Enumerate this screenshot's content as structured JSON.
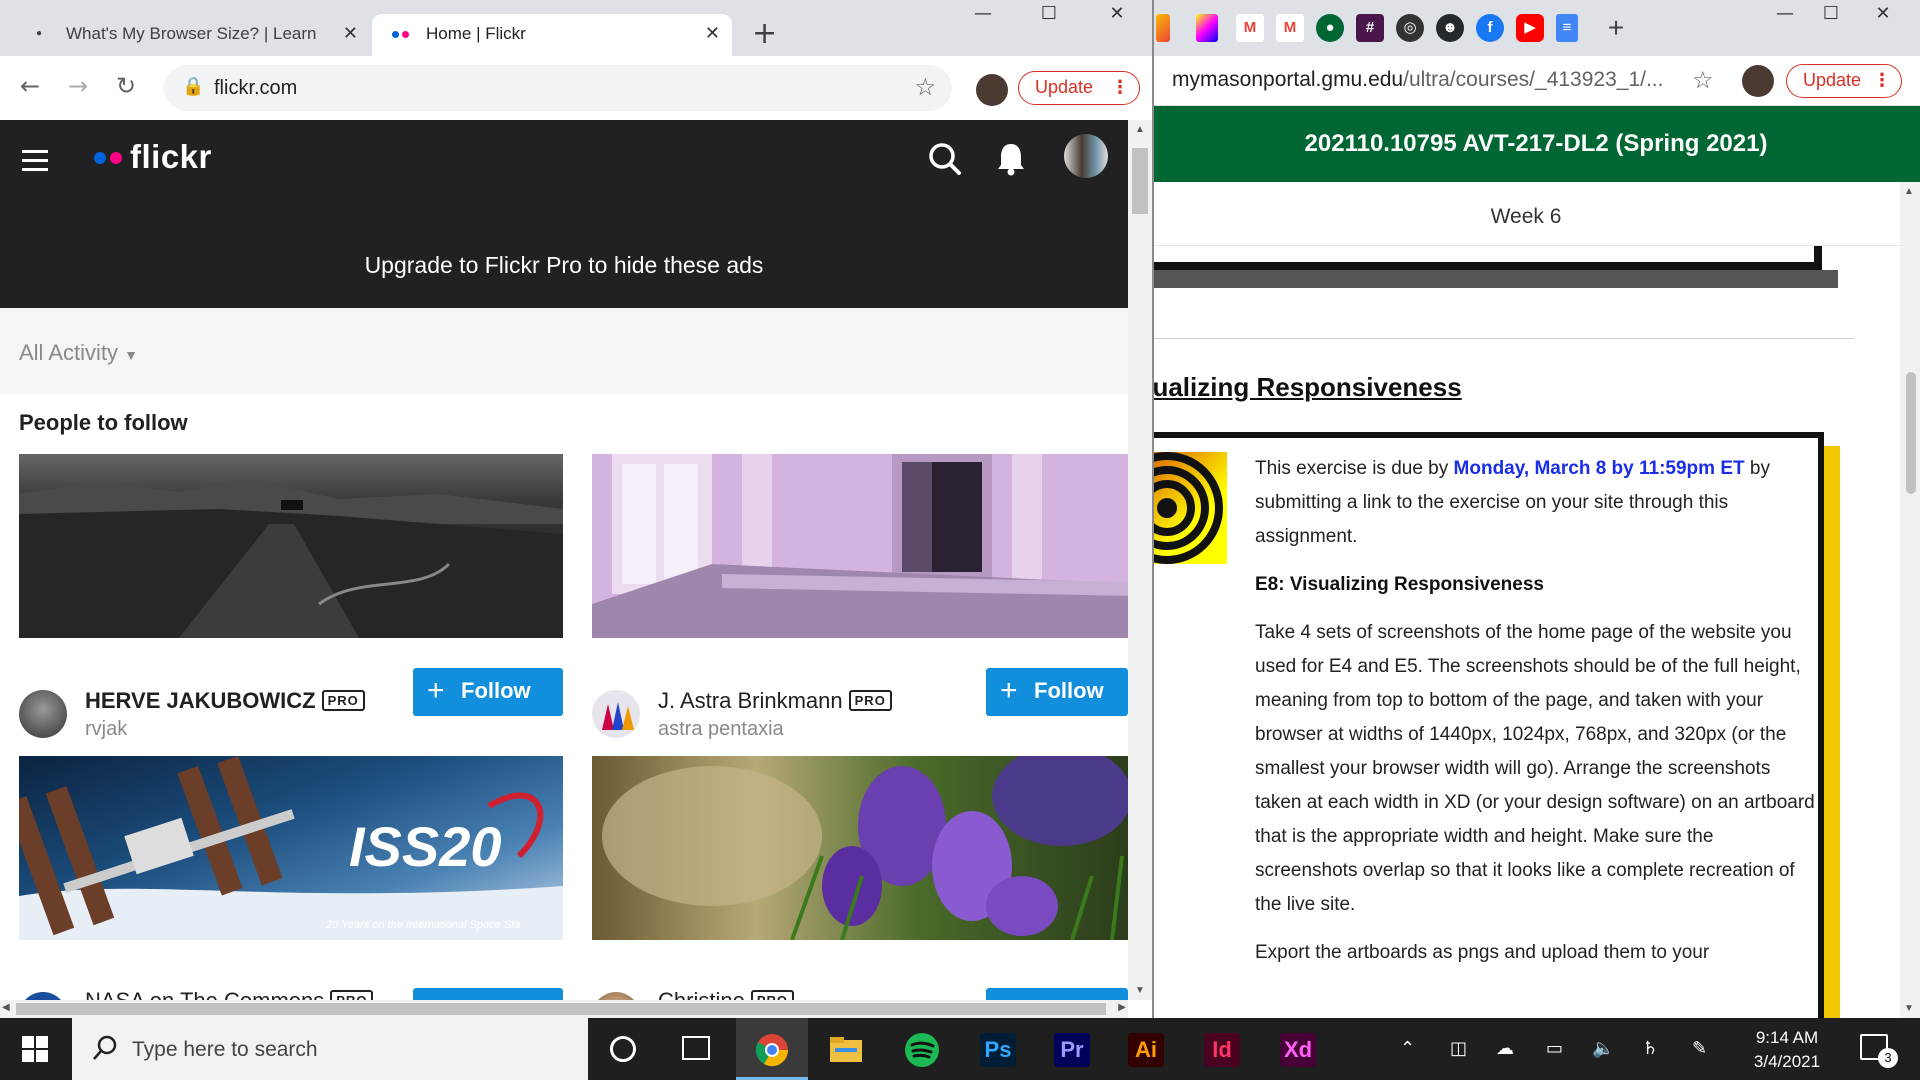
{
  "left_window": {
    "tabs": [
      {
        "title": "What's My Browser Size? | Learn",
        "active": false
      },
      {
        "title": "Home | Flickr",
        "active": true
      }
    ],
    "url": "flickr.com",
    "update_label": "Update"
  },
  "flickr": {
    "logo_text": "flickr",
    "ad_text": "Upgrade to Flickr Pro to hide these ads",
    "activity_filter": "All Activity",
    "section_title": "People to follow",
    "follow_label": "Follow",
    "pro_label": "PRO",
    "people": [
      {
        "name": "HERVE JAKUBOWICZ",
        "username": "rvjak"
      },
      {
        "name": "J. Astra Brinkmann",
        "username": "astra pentaxia"
      },
      {
        "name": "NASA on The Commons",
        "username": ""
      },
      {
        "name": "Christine",
        "username": ""
      }
    ],
    "iss_caption": "20 Years on the International Space Sta"
  },
  "right_window": {
    "url_host": "mymasonportal.gmu.edu",
    "url_path": "/ultra/courses/_413923_1/...",
    "update_label": "Update",
    "course_title": "202110.10795 AVT-217-DL2 (Spring 2021)",
    "week_label": "Week 6",
    "heading": "sualizing Responsiveness",
    "due_prefix": "This exercise is due by",
    "due_date": "Monday, March 8 by 11:59pm ET",
    "due_suffix": "by submitting a link to the exercise on your site through this assignment.",
    "exercise_title": "E8: Visualizing Responsiveness",
    "body_paragraph": "Take 4 sets of screenshots of the home page of the website you used for E4 and E5. The screenshots should be of the full height, meaning from top to bottom of the page, and taken with your browser at widths of 1440px, 1024px, 768px, and 320px (or the smallest your browser width will go). Arrange the screenshots taken at each width in XD (or your design software) on an artboard that is the appropriate width and height. Make sure the screenshots overlap so that it looks like a complete recreation of the live site.",
    "last_line": "Export the artboards as pngs and upload them to your"
  },
  "taskbar": {
    "search_placeholder": "Type here to search",
    "time": "9:14 AM",
    "date": "3/4/2021",
    "notification_count": "3",
    "apps": [
      {
        "name": "chrome",
        "label": ""
      },
      {
        "name": "file-explorer",
        "label": ""
      },
      {
        "name": "spotify",
        "label": ""
      },
      {
        "name": "photoshop",
        "label": "Ps",
        "color": "#31a8ff",
        "bg": "#001e36"
      },
      {
        "name": "premiere",
        "label": "Pr",
        "color": "#9999ff",
        "bg": "#00005b"
      },
      {
        "name": "illustrator",
        "label": "Ai",
        "color": "#ff9a00",
        "bg": "#330000"
      },
      {
        "name": "indesign",
        "label": "Id",
        "color": "#ff3366",
        "bg": "#49021f"
      },
      {
        "name": "xd",
        "label": "Xd",
        "color": "#ff61f6",
        "bg": "#470137"
      }
    ]
  }
}
